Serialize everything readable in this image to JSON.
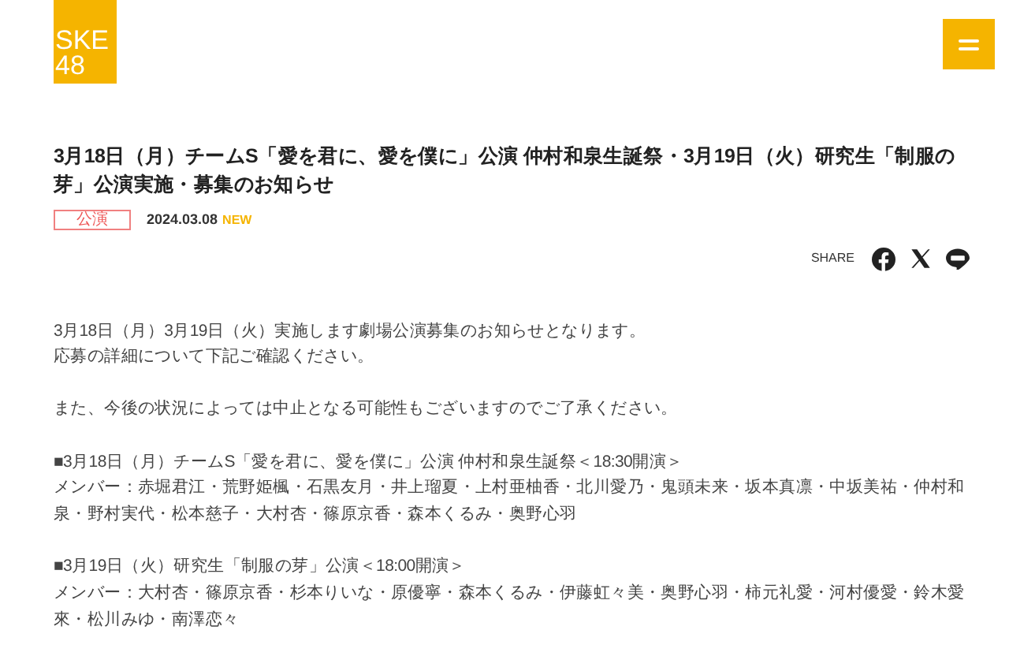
{
  "header": {
    "logo_lines": [
      "SKE",
      "48"
    ]
  },
  "article": {
    "title": "3月18日（月）チームS「愛を君に、愛を僕に」公演 仲村和泉生誕祭・3月19日（火）研究生「制服の芽」公演実施・募集のお知らせ",
    "category": "公演",
    "date": "2024.03.08",
    "new_badge": "NEW",
    "share_label": "SHARE",
    "paragraphs": [
      [
        "3月18日（月）3月19日（火）実施します劇場公演募集のお知らせとなります。",
        "応募の詳細について下記ご確認ください。"
      ],
      [
        "また、今後の状況によっては中止となる可能性もございますのでご了承ください。"
      ],
      [
        "■3月18日（月）チームS「愛を君に、愛を僕に」公演 仲村和泉生誕祭＜18:30開演＞",
        "メンバー：赤堀君江・荒野姫楓・石黒友月・井上瑠夏・上村亜柚香・北川愛乃・鬼頭未来・坂本真凛・中坂美祐・仲村和泉・野村実代・松本慈子・大村杏・篠原京香・森本くるみ・奥野心羽"
      ],
      [
        "■3月19日（火）研究生「制服の芽」公演＜18:00開演＞",
        "メンバー：大村杏・篠原京香・杉本りいな・原優寧・森本くるみ・伊藤虹々美・奥野心羽・柿元礼愛・河村優愛・鈴木愛來・松川みゆ・南澤恋々"
      ]
    ]
  }
}
